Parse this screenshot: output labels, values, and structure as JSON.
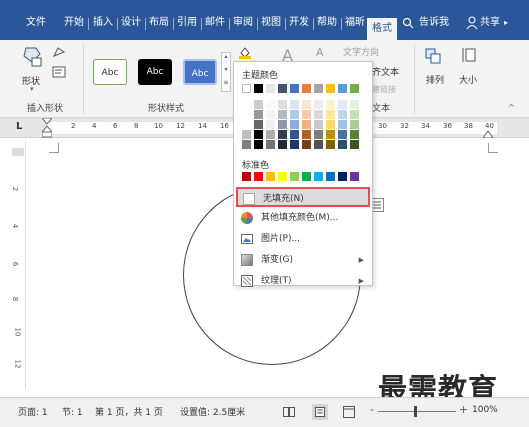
{
  "tabs": [
    "文件",
    "开始",
    "插入",
    "设计",
    "布局",
    "引用",
    "邮件",
    "审阅",
    "视图",
    "开发",
    "帮助",
    "福昕",
    "格式"
  ],
  "tell_me": "告诉我",
  "share": "共享",
  "ribbon": {
    "insert_shapes_label": "插入形状",
    "shape_label": "形状",
    "shape_styles_label": "形状样式",
    "style_samples": [
      "Abc",
      "Abc",
      "Abc"
    ],
    "text_direction": "文字方向",
    "align_text": "齐文本",
    "create_link": "建链接",
    "text_group": "文本",
    "arrange": "排列",
    "size": "大小"
  },
  "ruler_numbers": [
    "2",
    "4",
    "6",
    "8",
    "10",
    "12",
    "14",
    "16",
    "30",
    "32",
    "34",
    "36",
    "38",
    "40"
  ],
  "vruler_numbers": [
    "2",
    "4",
    "6",
    "8",
    "10",
    "12"
  ],
  "menu": {
    "theme_colors": "主题颜色",
    "standard_colors": "标准色",
    "items": [
      {
        "label": "无填充(N)",
        "icon": "no-fill-icon",
        "arrow": ""
      },
      {
        "label": "其他填充颜色(M)...",
        "icon": "color-wheel-icon",
        "arrow": ""
      },
      {
        "label": "图片(P)...",
        "icon": "picture-icon",
        "arrow": ""
      },
      {
        "label": "渐变(G)",
        "icon": "gradient-icon",
        "arrow": "▶"
      },
      {
        "label": "纹理(T)",
        "icon": "texture-icon",
        "arrow": "▶"
      }
    ],
    "theme_row": [
      "#ffffff",
      "#000000",
      "#e7e6e6",
      "#44546a",
      "#4472c4",
      "#ed7d31",
      "#a5a5a5",
      "#ffc000",
      "#5b9bd5",
      "#70ad47"
    ],
    "standard_row": [
      "#c00000",
      "#ff0000",
      "#ffc000",
      "#ffff00",
      "#92d050",
      "#00b050",
      "#00b0f0",
      "#0070c0",
      "#002060",
      "#7030a0"
    ]
  },
  "status": {
    "page": "页面: 1",
    "section": "节: 1",
    "page_of": "第 1 页，共 1 页",
    "setting": "设置值: 2.5厘米",
    "zoom": "100%"
  },
  "watermark": "最需教育"
}
